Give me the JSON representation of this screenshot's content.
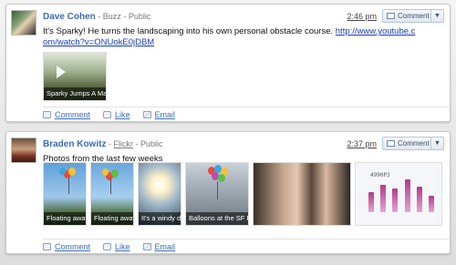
{
  "posts": [
    {
      "author": "Dave Cohen",
      "source_prefix": " - ",
      "source": "Buzz",
      "visibility_prefix": " - ",
      "visibility": "Public",
      "time": "2:46 pm",
      "comment_button": "Comment",
      "text": "It's Sparky! He turns the landscaping into his own personal obstacle course.",
      "url_line1": "http://www.youtube.c",
      "url_line2": "om/watch?v=ONUokE0jDBM",
      "thumbnails": [
        {
          "caption": "Sparky Jumps A Massi"
        }
      ],
      "actions": {
        "comment": "Comment",
        "like": "Like",
        "email": "Email"
      }
    },
    {
      "author": "Braden Kowitz",
      "source_prefix": " - ",
      "source": "Flickr",
      "visibility_prefix": " - ",
      "visibility": "Public",
      "time": "2:37 pm",
      "comment_button": "Comment",
      "text": "Photos from the last few weeks",
      "thumbnails": [
        {
          "caption": "Floating away"
        },
        {
          "caption": "Floating away"
        },
        {
          "caption": "It's a windy day"
        },
        {
          "caption": "Balloons at the SF Ferr"
        },
        {
          "caption": ""
        },
        {
          "caption": ""
        }
      ],
      "chart_label": "4990PJ",
      "actions": {
        "comment": "Comment",
        "like": "Like",
        "email": "Email"
      }
    }
  ],
  "icons": {
    "caret": "▼"
  }
}
